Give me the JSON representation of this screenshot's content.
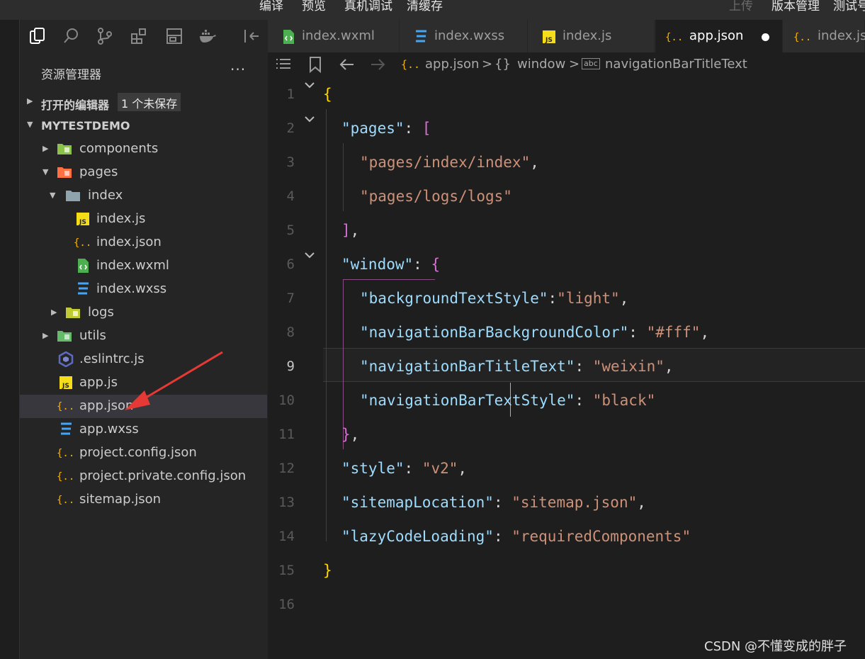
{
  "menu": {
    "items": [
      "编译",
      "预览",
      "真机调试",
      "清缓存"
    ],
    "right_items": [
      "上传",
      "版本管理",
      "测试号"
    ]
  },
  "sidebar": {
    "toolbar_icons": [
      "files-icon",
      "search-icon",
      "source-control-icon",
      "extensions-icon",
      "layout-icon",
      "docker-icon",
      "collapse-icon"
    ],
    "title": "资源管理器",
    "more": "···",
    "open_editors": {
      "label": "打开的编辑器",
      "badge": "1 个未保存"
    },
    "project": "MYTESTDEMO",
    "tree": [
      {
        "name": "components",
        "icon": "folder-components-icon"
      },
      {
        "name": "pages",
        "icon": "folder-pages-icon"
      },
      {
        "name": "index",
        "icon": "folder-icon"
      },
      {
        "name": "index.js",
        "icon": "js-file-icon"
      },
      {
        "name": "index.json",
        "icon": "json-file-icon"
      },
      {
        "name": "index.wxml",
        "icon": "wxml-file-icon"
      },
      {
        "name": "index.wxss",
        "icon": "wxss-file-icon"
      },
      {
        "name": "logs",
        "icon": "folder-icon"
      },
      {
        "name": "utils",
        "icon": "folder-utils-icon"
      },
      {
        "name": ".eslintrc.js",
        "icon": "eslint-file-icon"
      },
      {
        "name": "app.js",
        "icon": "js-file-icon"
      },
      {
        "name": "app.json",
        "icon": "json-file-icon"
      },
      {
        "name": "app.wxss",
        "icon": "wxss-file-icon"
      },
      {
        "name": "project.config.json",
        "icon": "json-file-icon"
      },
      {
        "name": "project.private.config.json",
        "icon": "json-file-icon"
      },
      {
        "name": "sitemap.json",
        "icon": "json-file-icon"
      }
    ]
  },
  "tabs": [
    {
      "label": "index.wxml",
      "icon": "wxml-file-icon"
    },
    {
      "label": "index.wxss",
      "icon": "wxss-file-icon"
    },
    {
      "label": "index.js",
      "icon": "js-file-icon"
    },
    {
      "label": "app.json",
      "icon": "json-file-icon"
    },
    {
      "label": "index.js",
      "icon": "json-file-icon"
    }
  ],
  "breadcrumbs": {
    "file": "app.json",
    "sep": ">",
    "object_icon": "{}",
    "object": "window",
    "property": "navigationBarTitleText",
    "property_icon": "abc"
  },
  "code": {
    "line_numbers": [
      "1",
      "2",
      "3",
      "4",
      "5",
      "6",
      "7",
      "8",
      "9",
      "10",
      "11",
      "12",
      "13",
      "14",
      "15",
      "16"
    ],
    "current_line": "9",
    "lines": [
      [
        [
          "brace",
          "{"
        ]
      ],
      [
        [
          "key",
          "\"pages\""
        ],
        [
          "punc",
          ": "
        ],
        [
          "brack",
          "["
        ]
      ],
      [
        [
          "str",
          "\"pages/index/index\""
        ],
        [
          "punc",
          ","
        ]
      ],
      [
        [
          "str",
          "\"pages/logs/logs\""
        ]
      ],
      [
        [
          "brack",
          "]"
        ],
        [
          "punc",
          ","
        ]
      ],
      [
        [
          "key",
          "\"window\""
        ],
        [
          "punc",
          ": "
        ],
        [
          "brack",
          "{"
        ]
      ],
      [
        [
          "key",
          "\"backgroundTextStyle\""
        ],
        [
          "punc",
          ":"
        ],
        [
          "str",
          "\"light\""
        ],
        [
          "punc",
          ","
        ]
      ],
      [
        [
          "key",
          "\"navigationBarBackgroundColor\""
        ],
        [
          "punc",
          ": "
        ],
        [
          "str",
          "\"#fff\""
        ],
        [
          "punc",
          ","
        ]
      ],
      [
        [
          "key",
          "\"navigationBarTitleText\""
        ],
        [
          "punc",
          ": "
        ],
        [
          "str",
          "\"weixin\""
        ],
        [
          "punc",
          ","
        ]
      ],
      [
        [
          "key",
          "\"navigationBarTextStyle\""
        ],
        [
          "punc",
          ": "
        ],
        [
          "str",
          "\"black\""
        ]
      ],
      [
        [
          "brack",
          "}"
        ],
        [
          "punc",
          ","
        ]
      ],
      [
        [
          "key",
          "\"style\""
        ],
        [
          "punc",
          ": "
        ],
        [
          "str",
          "\"v2\""
        ],
        [
          "punc",
          ","
        ]
      ],
      [
        [
          "key",
          "\"sitemapLocation\""
        ],
        [
          "punc",
          ": "
        ],
        [
          "str",
          "\"sitemap.json\""
        ],
        [
          "punc",
          ","
        ]
      ],
      [
        [
          "key",
          "\"lazyCodeLoading\""
        ],
        [
          "punc",
          ": "
        ],
        [
          "str",
          "\"requiredComponents\""
        ]
      ],
      [
        [
          "brace",
          "}"
        ]
      ],
      []
    ]
  },
  "watermark": "CSDN @不懂变成的胖子",
  "colors": {
    "key": "#9cdcfe",
    "string": "#ce9178",
    "brace": "#ffd700",
    "bracket": "#da70d6",
    "annotation_arrow": "#e53935"
  }
}
